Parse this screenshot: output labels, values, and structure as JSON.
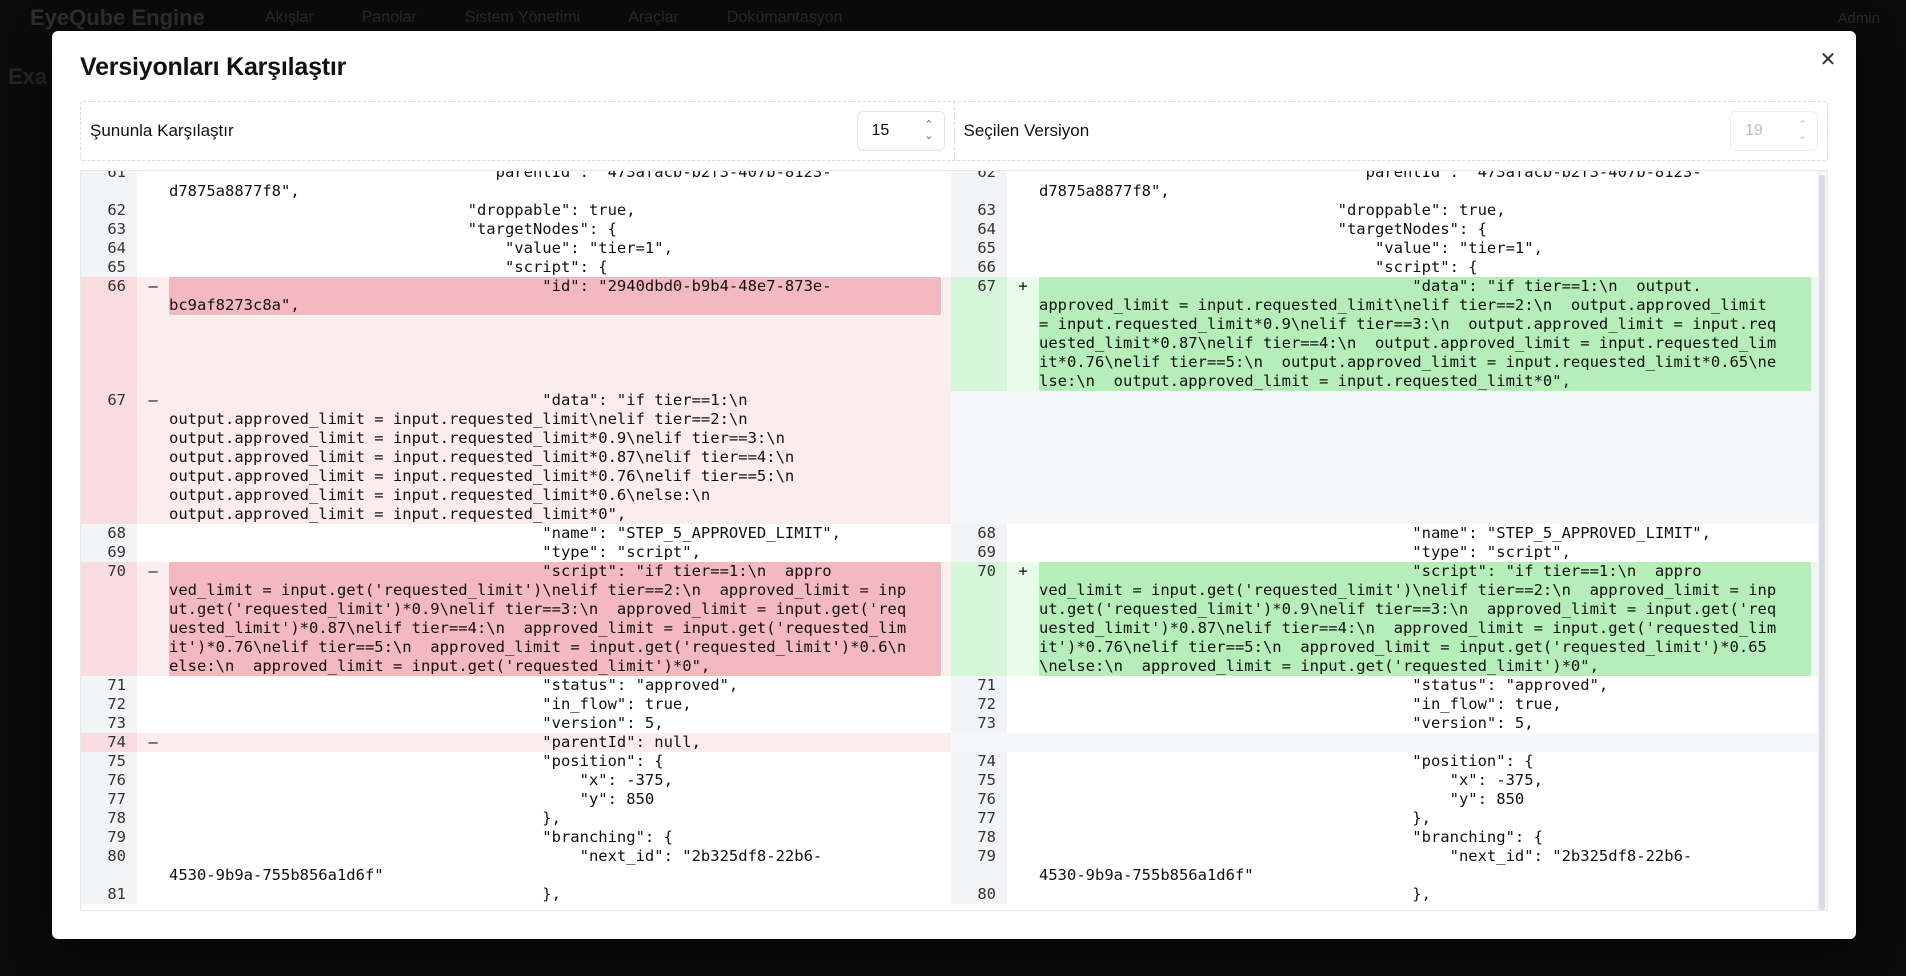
{
  "background": {
    "app_name": "EyeQube Engine",
    "nav": [
      "Akışlar",
      "Panolar",
      "Sistem Yönetimi",
      "Araçlar",
      "Dokümantasyon"
    ],
    "user": "Admin",
    "page_title": "Exa"
  },
  "modal": {
    "title": "Versiyonları Karşılaştır",
    "close_icon": "close-icon",
    "compare_label": "Şunu⁠nla Karşılaştır",
    "compare_value": "15",
    "selected_label": "Seçilen Versiyon",
    "selected_value": "19"
  },
  "diff": {
    "left": [
      {
        "n": "61",
        "t": "context",
        "c": "                                  \"parentId\": \"473afacb-b2f3-407b-8123-\nd7875a8877f8\","
      },
      {
        "n": "62",
        "t": "context",
        "c": "                                \"droppable\": true,"
      },
      {
        "n": "63",
        "t": "context",
        "c": "                                \"targetNodes\": {"
      },
      {
        "n": "64",
        "t": "context",
        "c": "                                    \"value\": \"tier=1\","
      },
      {
        "n": "65",
        "t": "context",
        "c": "                                    \"script\": {"
      },
      {
        "n": "66",
        "t": "del",
        "c": "                                        \"id\": \"2940dbd0-b9b4-48e7-873e-\nbc9af8273c8a\","
      },
      {
        "n": "67",
        "t": "del-plain",
        "c": "                                        \"data\": \"if tier==1:\\n\noutput.approved_limit = input.requested_limit\\nelif tier==2:\\n\noutput.approved_limit = input.requested_limit*0.9\\nelif tier==3:\\n\noutput.approved_limit = input.requested_limit*0.87\\nelif tier==4:\\n\noutput.approved_limit = input.requested_limit*0.76\\nelif tier==5:\\n\noutput.approved_limit = input.requested_limit*0.6\\nelse:\\n\noutput.approved_limit = input.requested_limit*0\","
      },
      {
        "n": "68",
        "t": "context",
        "c": "                                        \"name\": \"STEP_5_APPROVED_LIMIT\","
      },
      {
        "n": "69",
        "t": "context",
        "c": "                                        \"type\": \"script\","
      },
      {
        "n": "70",
        "t": "del",
        "c": "                                        \"script\": \"if tier==1:\\n  appro\nved_limit = input.get('requested_limit')\\nelif tier==2:\\n  approved_limit = inp\nut.get('requested_limit')*0.9\\nelif tier==3:\\n  approved_limit = input.get('req\nuested_limit')*0.87\\nelif tier==4:\\n  approved_limit = input.get('requested_lim\nit')*0.76\\nelif tier==5:\\n  approved_limit = input.get('requested_limit')*0.6\\n\nelse:\\n  approved_limit = input.get('requested_limit')*0\","
      },
      {
        "n": "71",
        "t": "context",
        "c": "                                        \"status\": \"approved\","
      },
      {
        "n": "72",
        "t": "context",
        "c": "                                        \"in_flow\": true,"
      },
      {
        "n": "73",
        "t": "context",
        "c": "                                        \"version\": 5,"
      },
      {
        "n": "74",
        "t": "del-plain",
        "c": "                                        \"parentId\": null,"
      },
      {
        "n": "75",
        "t": "context",
        "c": "                                        \"position\": {"
      },
      {
        "n": "76",
        "t": "context",
        "c": "                                            \"x\": -375,"
      },
      {
        "n": "77",
        "t": "context",
        "c": "                                            \"y\": 850"
      },
      {
        "n": "78",
        "t": "context",
        "c": "                                        },"
      },
      {
        "n": "79",
        "t": "context",
        "c": "                                        \"branching\": {"
      },
      {
        "n": "80",
        "t": "context",
        "c": "                                            \"next_id\": \"2b325df8-22b6-\n4530-9b9a-755b856a1d6f\""
      },
      {
        "n": "81",
        "t": "context",
        "c": "                                        },"
      }
    ],
    "right": [
      {
        "n": "62",
        "t": "context",
        "c": "                                  \"parentId\": \"473afacb-b2f3-407b-8123-\nd7875a8877f8\","
      },
      {
        "n": "63",
        "t": "context",
        "c": "                                \"droppable\": true,"
      },
      {
        "n": "64",
        "t": "context",
        "c": "                                \"targetNodes\": {"
      },
      {
        "n": "65",
        "t": "context",
        "c": "                                    \"value\": \"tier=1\","
      },
      {
        "n": "66",
        "t": "context",
        "c": "                                    \"script\": {"
      },
      {
        "n": "67",
        "t": "ins",
        "c": "                                        \"data\": \"if tier==1:\\n  output.\napproved_limit = input.requested_limit\\nelif tier==2:\\n  output.approved_limit\n= input.requested_limit*0.9\\nelif tier==3:\\n  output.approved_limit = input.req\nuested_limit*0.87\\nelif tier==4:\\n  output.approved_limit = input.requested_lim\nit*0.76\\nelif tier==5:\\n  output.approved_limit = input.requested_limit*0.65\\ne\nlse:\\n  output.approved_limit = input.requested_limit*0\","
      },
      {
        "n": "",
        "t": "empty",
        "c": "\n\n\n\n\n\n"
      },
      {
        "n": "68",
        "t": "context",
        "c": "                                        \"name\": \"STEP_5_APPROVED_LIMIT\","
      },
      {
        "n": "69",
        "t": "context",
        "c": "                                        \"type\": \"script\","
      },
      {
        "n": "70",
        "t": "ins",
        "c": "                                        \"script\": \"if tier==1:\\n  appro\nved_limit = input.get('requested_limit')\\nelif tier==2:\\n  approved_limit = inp\nut.get('requested_limit')*0.9\\nelif tier==3:\\n  approved_limit = input.get('req\nuested_limit')*0.87\\nelif tier==4:\\n  approved_limit = input.get('requested_lim\nit')*0.76\\nelif tier==5:\\n  approved_limit = input.get('requested_limit')*0.65\n\\nelse:\\n  approved_limit = input.get('requested_limit')*0\","
      },
      {
        "n": "71",
        "t": "context",
        "c": "                                        \"status\": \"approved\","
      },
      {
        "n": "72",
        "t": "context",
        "c": "                                        \"in_flow\": true,"
      },
      {
        "n": "73",
        "t": "context",
        "c": "                                        \"version\": 5,"
      },
      {
        "n": "",
        "t": "empty",
        "c": ""
      },
      {
        "n": "74",
        "t": "context",
        "c": "                                        \"position\": {"
      },
      {
        "n": "75",
        "t": "context",
        "c": "                                            \"x\": -375,"
      },
      {
        "n": "76",
        "t": "context",
        "c": "                                            \"y\": 850"
      },
      {
        "n": "77",
        "t": "context",
        "c": "                                        },"
      },
      {
        "n": "78",
        "t": "context",
        "c": "                                        \"branching\": {"
      },
      {
        "n": "79",
        "t": "context",
        "c": "                                            \"next_id\": \"2b325df8-22b6-\n4530-9b9a-755b856a1d6f\""
      },
      {
        "n": "80",
        "t": "context",
        "c": "                                        },"
      }
    ]
  },
  "colors": {
    "deleted_highlight": "#f3b8c0",
    "deleted_background": "#fbecee",
    "inserted_highlight": "#b6eeb9",
    "inserted_background": "#e9fbea"
  }
}
